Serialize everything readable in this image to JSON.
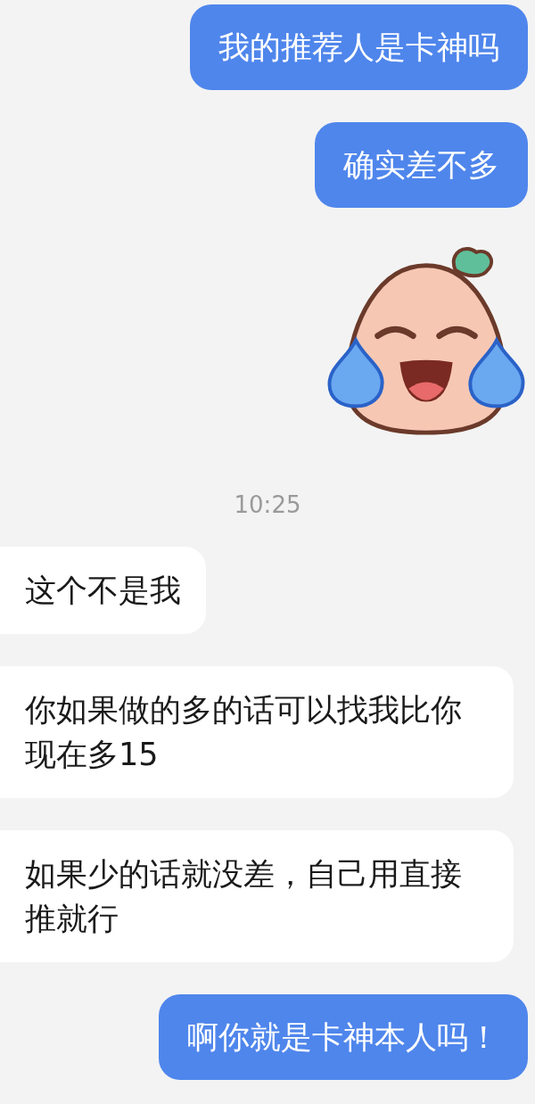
{
  "messages": [
    {
      "kind": "text",
      "outgoing": true,
      "text": "我的推荐人是卡神吗"
    },
    {
      "kind": "text",
      "outgoing": true,
      "text": "确实差不多"
    },
    {
      "kind": "sticker",
      "outgoing": true
    },
    {
      "kind": "time",
      "text": "10:25"
    },
    {
      "kind": "text",
      "outgoing": false,
      "text": "这个不是我"
    },
    {
      "kind": "text",
      "outgoing": false,
      "text": "你如果做的多的话可以找我比你现在多15"
    },
    {
      "kind": "text",
      "outgoing": false,
      "text": "如果少的话就没差，自己用直接推就行"
    },
    {
      "kind": "text",
      "outgoing": true,
      "text": "啊你就是卡神本人吗！"
    }
  ]
}
